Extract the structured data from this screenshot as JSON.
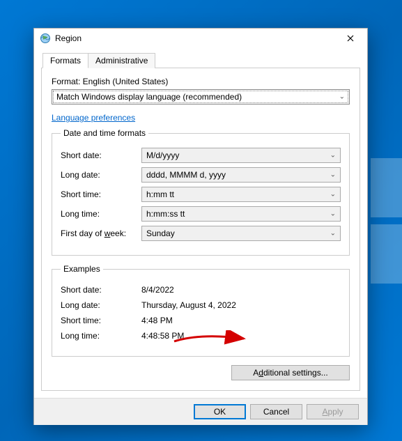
{
  "window": {
    "title": "Region"
  },
  "tabs": {
    "formats": "Formats",
    "administrative": "Administrative"
  },
  "format": {
    "label": "Format: English (United States)",
    "value": "Match Windows display language (recommended)"
  },
  "link_lang_prefs": "Language preferences",
  "group_datetime": "Date and time formats",
  "fields": {
    "short_date": {
      "label": "Short date:",
      "value": "M/d/yyyy"
    },
    "long_date": {
      "label": "Long date:",
      "value": "dddd, MMMM d, yyyy"
    },
    "short_time": {
      "label": "Short time:",
      "value": "h:mm tt"
    },
    "long_time": {
      "label": "Long time:",
      "value": "h:mm:ss tt"
    },
    "first_day": {
      "label_pre": "First day of ",
      "label_u": "w",
      "label_post": "eek:",
      "value": "Sunday"
    }
  },
  "group_examples": "Examples",
  "examples": {
    "short_date": {
      "label": "Short date:",
      "value": "8/4/2022"
    },
    "long_date": {
      "label": "Long date:",
      "value": "Thursday, August 4, 2022"
    },
    "short_time": {
      "label": "Short time:",
      "value": "4:48 PM"
    },
    "long_time": {
      "label": "Long time:",
      "value": "4:48:58 PM"
    }
  },
  "buttons": {
    "additional_pre": "A",
    "additional_u": "d",
    "additional_post": "ditional settings...",
    "ok": "OK",
    "cancel": "Cancel",
    "apply_u": "A",
    "apply_post": "pply"
  }
}
